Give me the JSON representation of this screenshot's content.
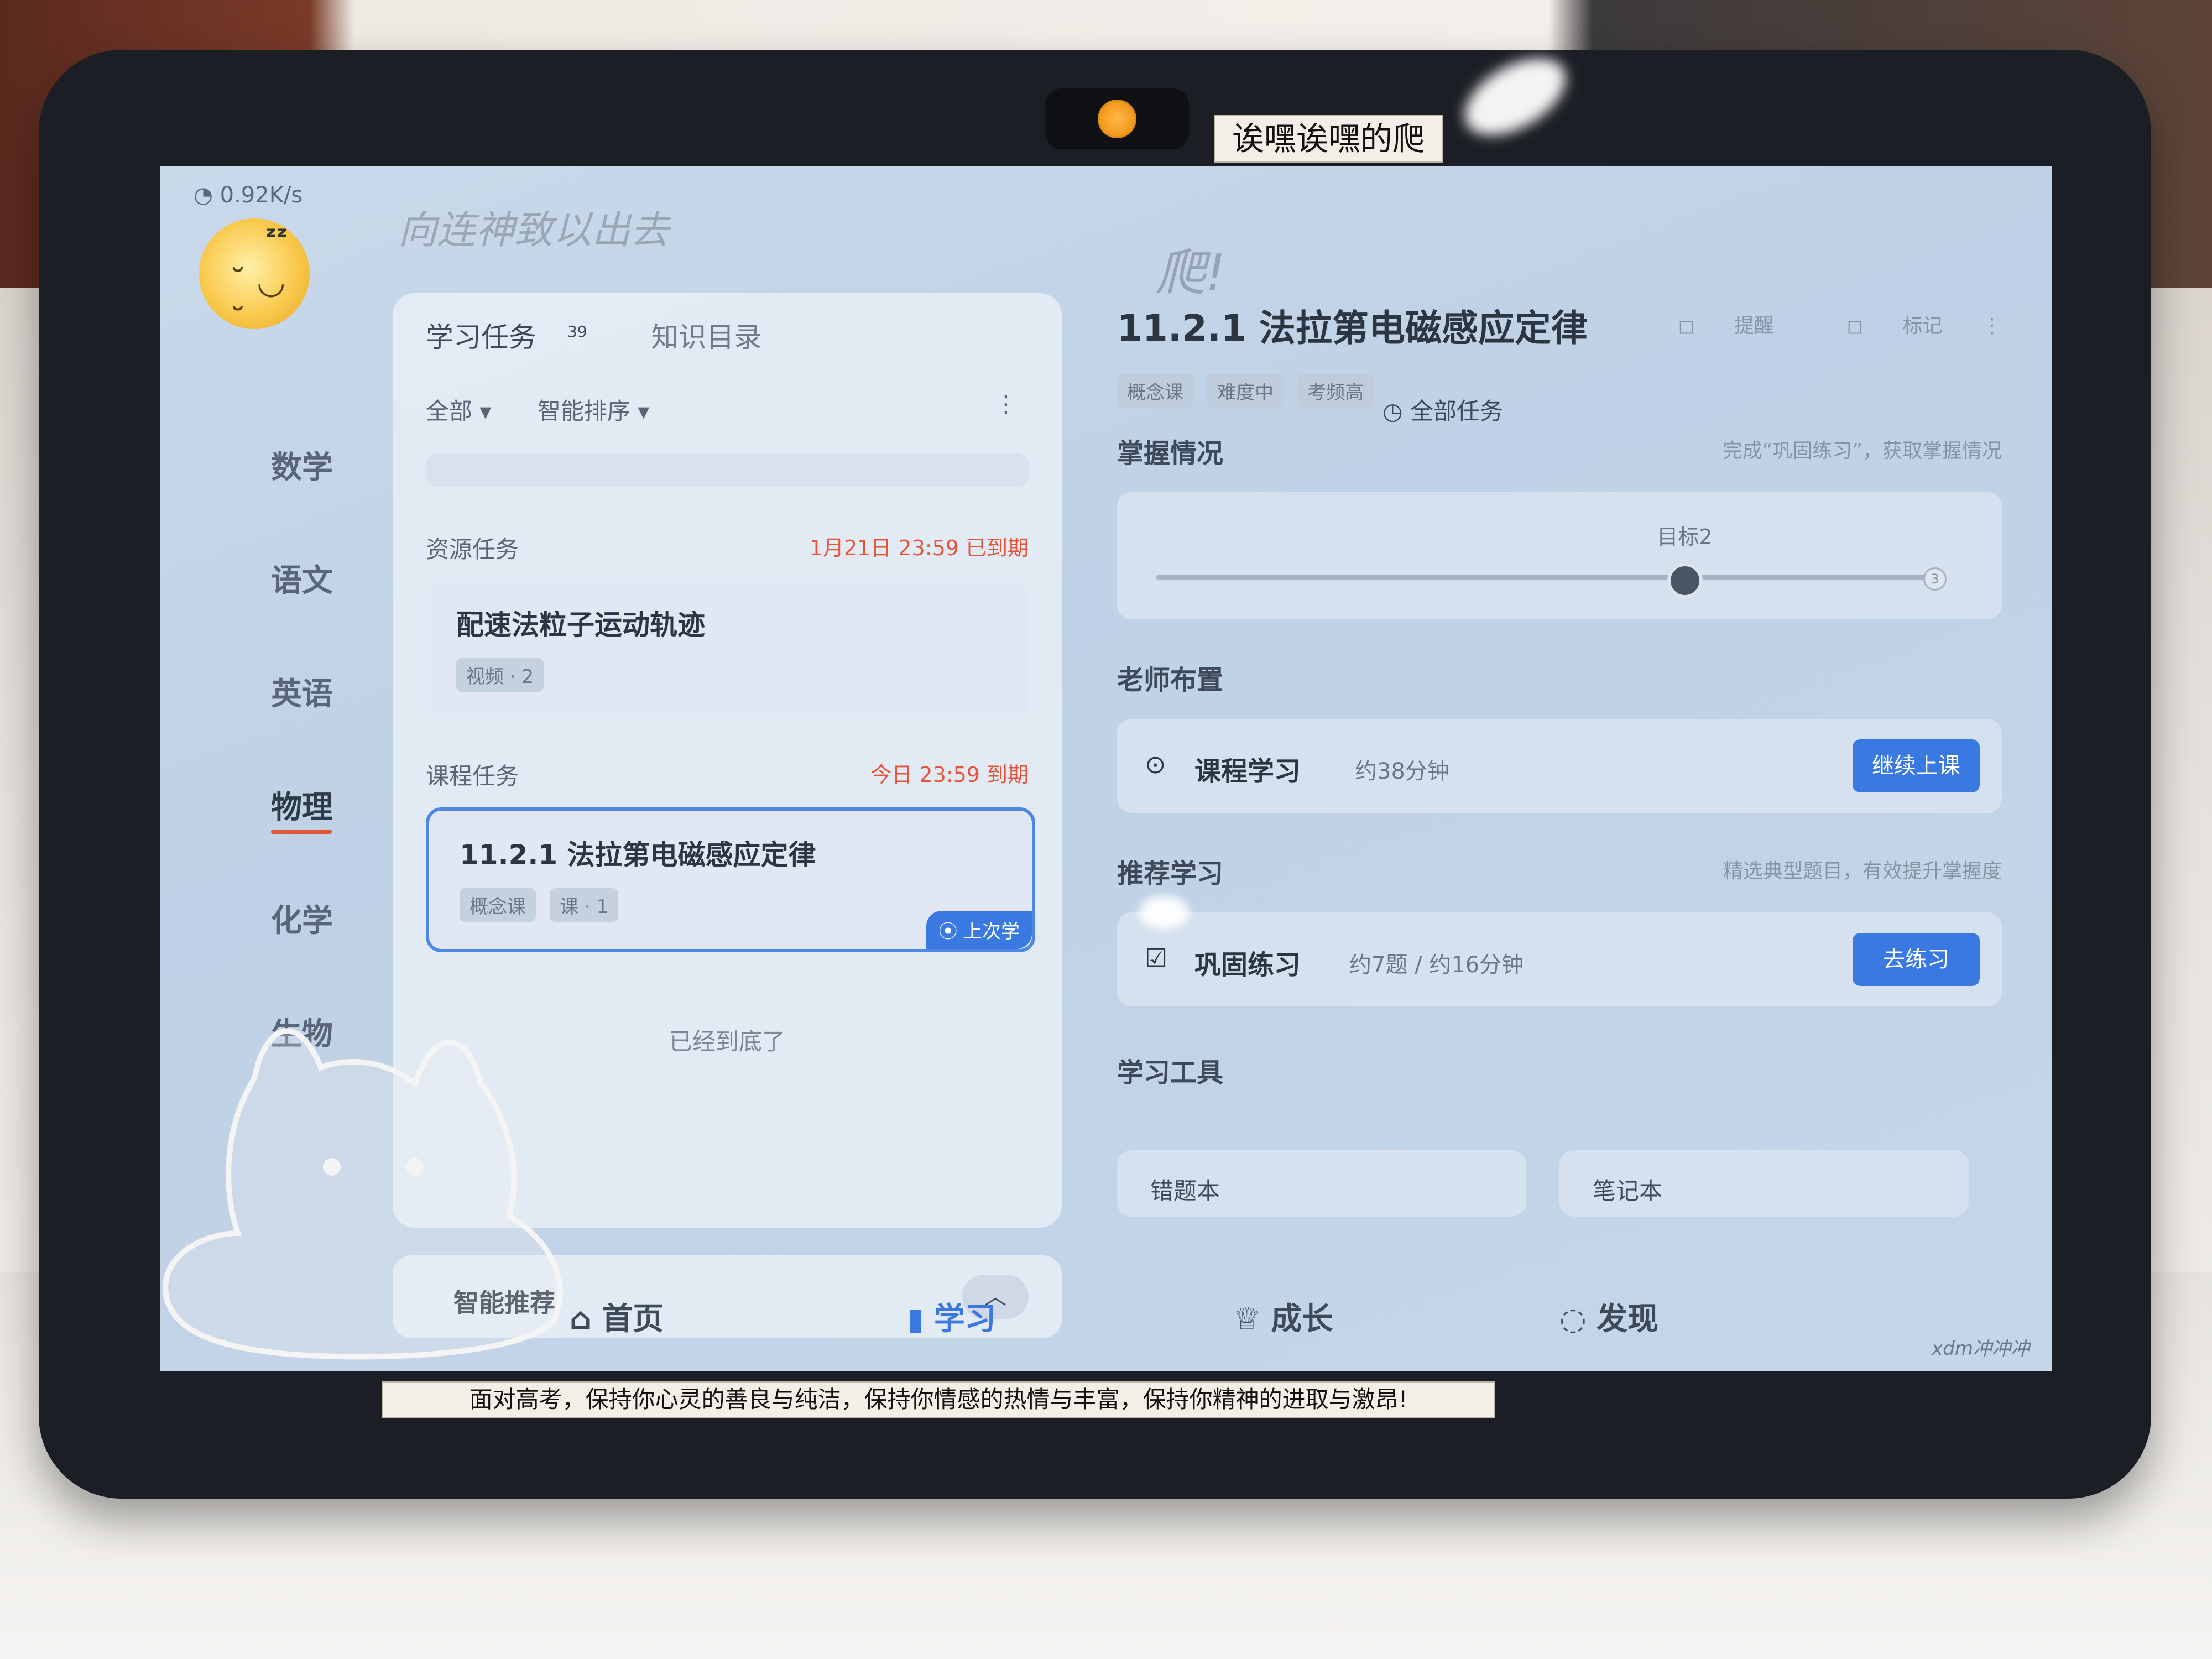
{
  "stickers": {
    "top": "诶嘿诶嘿的爬",
    "bottom": "面对高考，保持你心灵的善良与纯洁，保持你情感的热情与丰富，保持你精神的进取与激昂!"
  },
  "status_bar": {
    "net_speed": "0.92K/s"
  },
  "scribbles": {
    "left": "向连神致以出去",
    "mid": "爬!"
  },
  "sidebar": {
    "subjects": [
      "数学",
      "语文",
      "英语",
      "物理",
      "化学",
      "生物"
    ],
    "active_subject": "物理"
  },
  "task_panel": {
    "tab_tasks": "学习任务",
    "tab_tasks_count": "39",
    "tab_catalog": "知识目录",
    "filter_all": "全部",
    "filter_sort": "智能排序",
    "all_tasks": "全部任务",
    "resource_section": "资源任务",
    "resource_due": "1月21日 23:59 已到期",
    "resource_card": {
      "title": "配速法粒子运动轨迹",
      "tag": "视频 · 2"
    },
    "course_section": "课程任务",
    "course_due": "今日 23:59  到期",
    "course_card": {
      "title": "11.2.1  法拉第电磁感应定律",
      "tag1": "概念课",
      "tag2": "课 · 1",
      "badge": "上次学"
    },
    "end_note": "已经到底了"
  },
  "smart_recommend": {
    "label": "智能推荐"
  },
  "detail": {
    "title": "11.2.1  法拉第电磁感应定律",
    "tool_remind": "提醒",
    "tool_mark": "标记",
    "tags": [
      "概念课",
      "难度中",
      "考频高"
    ],
    "mastery_title": "掌握情况",
    "mastery_hint": "完成“巩固练习”，获取掌握情况",
    "mastery_target_label": "目标2",
    "mastery_end_label": "3",
    "mastery_level_fraction": 0.67,
    "teacher_title": "老师布置",
    "teacher_item": "课程学习",
    "teacher_duration": "约38分钟",
    "teacher_button": "继续上课",
    "recommend_title": "推荐学习",
    "recommend_hint": "精选典型题目，有效提升掌握度",
    "recommend_item": "巩固练习",
    "recommend_meta": "约7题 / 约16分钟",
    "recommend_button": "去练习",
    "tools_title": "学习工具",
    "tool_1": "错题本",
    "tool_2": "笔记本"
  },
  "bottom_nav": {
    "home": "首页",
    "study": "学习",
    "growth": "成长",
    "discover": "发现",
    "active": "学习"
  },
  "watermark": "xdm冲冲冲",
  "colors": {
    "accent": "#3a78e2",
    "due_red": "#e5533b",
    "screen_bg": "#c9d9ea"
  }
}
